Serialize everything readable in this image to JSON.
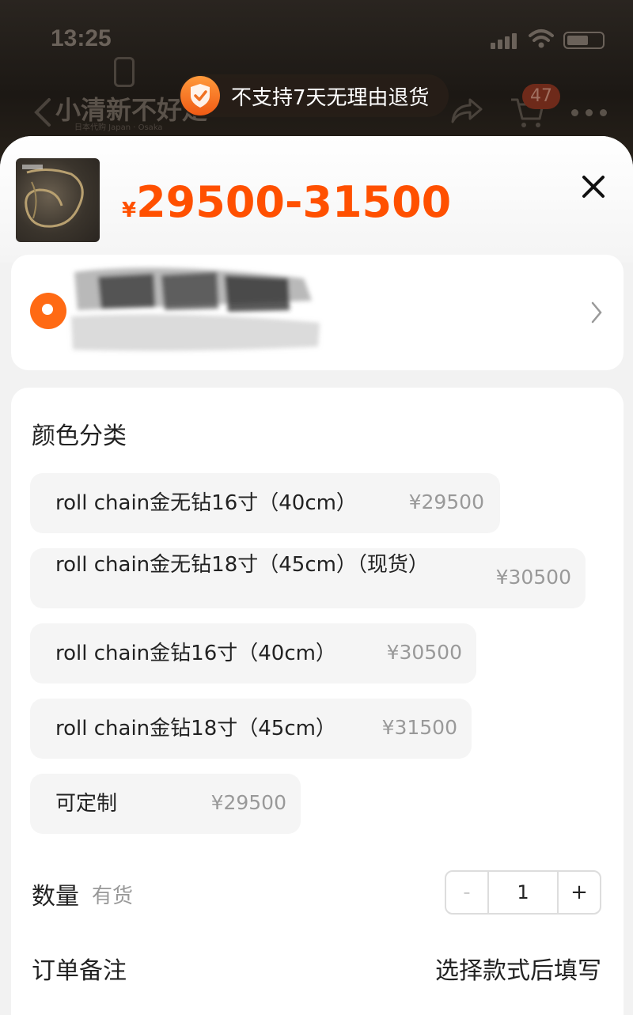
{
  "status_bar": {
    "time": "13:25"
  },
  "nav": {
    "store_name": "小清新不好走",
    "store_sub": "日本代购 Japan · Osaka",
    "cart_count": "47"
  },
  "toast": {
    "text": "不支持7天无理由退货"
  },
  "sheet": {
    "currency": "¥",
    "price_range": "29500-31500",
    "spec_section_title": "颜色分类",
    "options": [
      {
        "label": "roll chain金无钻16寸（40cm）",
        "price": "¥29500"
      },
      {
        "label": "roll chain金无钻18寸（45cm）（现货）",
        "price": "¥30500"
      },
      {
        "label": "roll chain金钻16寸（40cm）",
        "price": "¥30500"
      },
      {
        "label": "roll chain金钻18寸（45cm）",
        "price": "¥31500"
      },
      {
        "label": "可定制",
        "price": "¥29500"
      }
    ],
    "quantity_label": "数量",
    "stock_status": "有货",
    "quantity_minus": "-",
    "quantity_value": "1",
    "quantity_plus": "+",
    "note_label": "订单备注",
    "note_action": "选择款式后填写"
  },
  "colors": {
    "accent": "#ff5000",
    "location": "#ff6a14",
    "muted_text": "#999999"
  }
}
